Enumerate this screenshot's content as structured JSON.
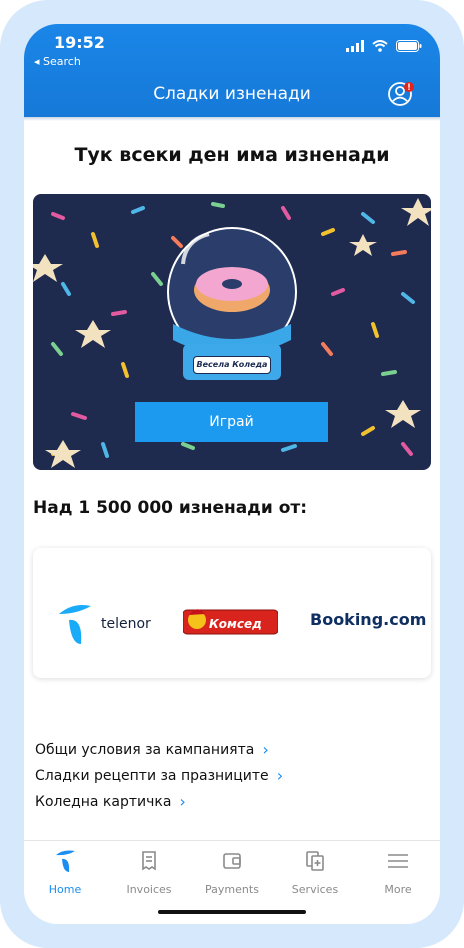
{
  "status_bar": {
    "time": "19:52",
    "back_label": "◂ Search"
  },
  "header": {
    "title": "Сладки изненади"
  },
  "main": {
    "headline": "Тук всеки ден има изненади",
    "promo": {
      "globe_label": "Весела Коледа",
      "play_button": "Играй"
    },
    "partners_title": "Над 1 500 000 изненади от:",
    "partners": [
      {
        "name": "telenor"
      },
      {
        "name": "Комсед"
      },
      {
        "name": "Booking.com"
      }
    ],
    "links": [
      "Общи условия за кампанията",
      "Сладки рецепти за празниците",
      "Коледна картичка"
    ]
  },
  "tabbar": {
    "tabs": [
      {
        "label": "Home"
      },
      {
        "label": "Invoices"
      },
      {
        "label": "Payments"
      },
      {
        "label": "Services"
      },
      {
        "label": "More"
      }
    ]
  },
  "colors": {
    "brand": "#1679d8",
    "accent": "#1b8ef0",
    "promo_bg": "#1e2a4e"
  }
}
